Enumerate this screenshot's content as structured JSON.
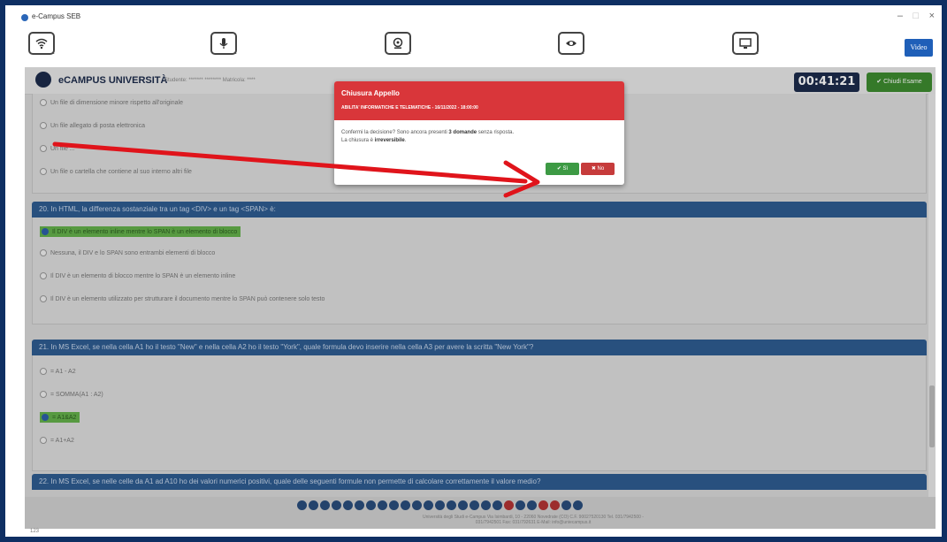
{
  "window": {
    "title": "e-Campus SEB",
    "minimize": "–",
    "maximize": "□",
    "close": "×",
    "video_label": "Video"
  },
  "toolbar_icons": [
    "wifi-icon",
    "microphone-icon",
    "webcam-icon",
    "eye-icon",
    "monitor-icon"
  ],
  "exam": {
    "logo_text": "eCAMPUS UNIVERSITÀ",
    "meta": "Studente: ******* ********  Matricola: ****",
    "timer": "00:41:21",
    "close_exam_label": "Chiudi Esame"
  },
  "q19": {
    "options": [
      "Un file di dimensione minore rispetto all'originale",
      "Un file allegato di posta elettronica",
      "Un file ...",
      "Un file o cartella che contiene al suo interno altri file"
    ]
  },
  "q20": {
    "title": "20. In HTML, la differenza sostanziale tra un tag <DIV> e un tag <SPAN> è:",
    "options": [
      "Il DIV è un elemento inline mentre lo SPAN è un elemento di blocco",
      "Nessuna, il DIV e lo SPAN sono entrambi elementi di blocco",
      "Il DIV è un elemento di blocco mentre lo SPAN è un elemento inline",
      "Il DIV è un elemento utilizzato per strutturare il documento mentre lo SPAN può contenere solo testo"
    ]
  },
  "q21": {
    "title": "21. In MS Excel, se nella cella A1 ho il testo \"New\" e nella cella A2 ho il testo \"York\", quale formula devo inserire nella cella A3 per avere la scritta \"New York\"?",
    "options": [
      "= A1 - A2",
      "= SOMMA(A1 : A2)",
      "= A1&A2",
      "= A1+A2"
    ]
  },
  "q22": {
    "title": "22. In MS Excel, se nelle celle da A1 ad A10 ho dei valori numerici positivi, quale delle seguenti formule non permette di calcolare correttamente il valore medio?"
  },
  "pager": {
    "footer": "Università degli Studi e-Campus Via Isimbardi, 10 - 22060 Novedrate (CO) C.F. 90027520130 Tel. 031/7942500 - 031/7942501 Fax: 031/792631 E-Mail: info@uniecampus.it"
  },
  "modal": {
    "title": "Chiusura Appello",
    "subtitle": "ABILITA' INFORMATICHE E TELEMATICHE - 16/11/2022 - 18:00:00",
    "body_prefix": "Confermi la decisione? Sono ancora presenti ",
    "body_bold": "3 domande",
    "body_suffix": " senza risposta.",
    "line2_prefix": "La chiusura è ",
    "line2_bold": "irreversibile",
    "line2_suffix": ".",
    "yes_label": "✔  Sì",
    "no_label": "✖  No"
  },
  "status": {
    "bottom_left": "123"
  },
  "colors": {
    "header_blue": "#2e5c90",
    "modal_red": "#d9363a",
    "arrow_red": "#e0141b",
    "yes_green": "#3d9a44"
  }
}
